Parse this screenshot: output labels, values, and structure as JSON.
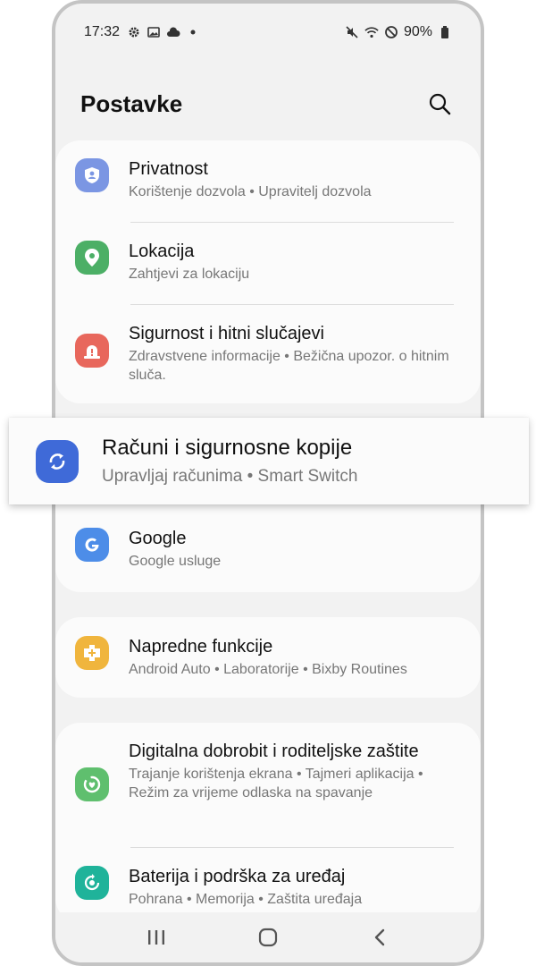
{
  "status_bar": {
    "time": "17:32",
    "left_icons": [
      "gear-icon",
      "image-icon",
      "cloud-icon",
      "dot-icon"
    ],
    "right_icons": [
      "mute-vibrate-icon",
      "wifi-icon",
      "do-not-disturb-icon",
      "battery-icon"
    ],
    "battery": "90%"
  },
  "header": {
    "title": "Postavke",
    "search_icon": "search-icon"
  },
  "cards": [
    {
      "items": [
        {
          "title": "Privatnost",
          "subtitle": "Korištenje dozvola  •  Upravitelj dozvola",
          "icon": "shield-person-icon",
          "color": "#7b96e3"
        },
        {
          "title": "Lokacija",
          "subtitle": "Zahtjevi za lokaciju",
          "icon": "location-pin-icon",
          "color": "#4caf66"
        },
        {
          "title": "Sigurnost i hitni slučajevi",
          "subtitle": "Zdravstvene informacije  •  Bežična upozor. o hitnim sluča.",
          "icon": "emergency-alert-icon",
          "color": "#e8675c"
        }
      ]
    },
    {
      "items": [
        {
          "title": "Google",
          "subtitle": "Google usluge",
          "icon": "google-icon",
          "color": "#4d8de8"
        }
      ]
    },
    {
      "items": [
        {
          "title": "Napredne funkcije",
          "subtitle": "Android Auto  •  Laboratorije  •  Bixby Routines",
          "icon": "advanced-features-icon",
          "color": "#f0b53d"
        }
      ]
    },
    {
      "items": [
        {
          "title": "Digitalna dobrobit i roditeljske zaštite",
          "subtitle": "Trajanje korištenja ekrana  •  Tajmeri aplikacija  •  Režim za vrijeme odlaska na spavanje",
          "icon": "digital-wellbeing-icon",
          "color": "#5fbf6e"
        },
        {
          "title": "Baterija i podrška za uređaj",
          "subtitle": "Pohrana  •  Memorija  •  Zaštita uređaja",
          "icon": "device-care-icon",
          "color": "#1fb39a"
        }
      ]
    }
  ],
  "highlighted_item": {
    "title": "Računi i sigurnosne kopije",
    "subtitle": "Upravljaj računima  •  Smart Switch",
    "icon": "sync-arrows-icon",
    "color": "#3f6ad8"
  },
  "nav_bar": {
    "icons": [
      "recent-apps-icon",
      "home-icon",
      "back-icon"
    ]
  }
}
